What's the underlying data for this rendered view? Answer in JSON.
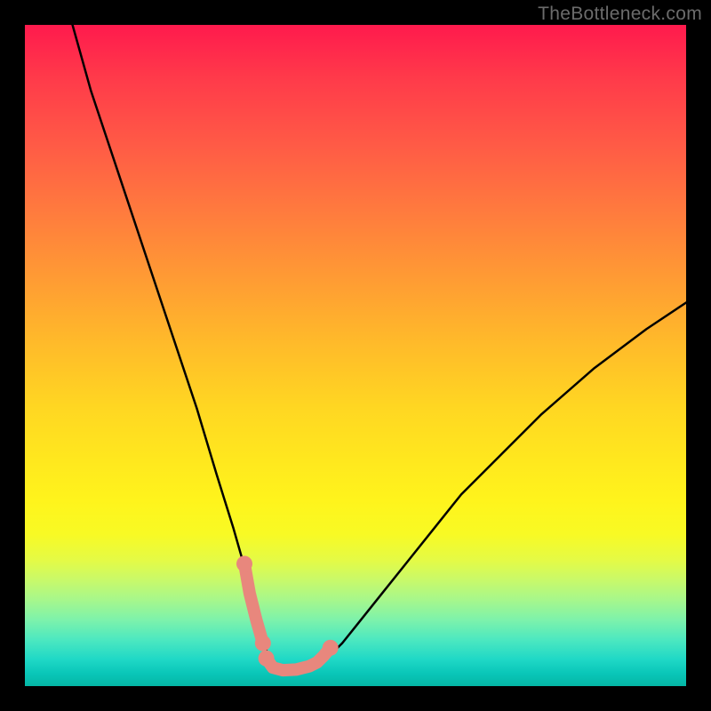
{
  "watermark": "TheBottleneck.com",
  "chart_data": {
    "type": "line",
    "title": "",
    "xlabel": "",
    "ylabel": "",
    "xlim": [
      0,
      100
    ],
    "ylim": [
      0,
      100
    ],
    "series": [
      {
        "name": "black-curve",
        "color": "#000000",
        "width": 2.5,
        "x": [
          7.2,
          10,
          14,
          18,
          22,
          26,
          29,
          31.5,
          33.5,
          35,
          36,
          37,
          38,
          40,
          42,
          44,
          46,
          48,
          50,
          54,
          58,
          62,
          66,
          72,
          78,
          86,
          94,
          100
        ],
        "y": [
          100,
          90,
          78,
          66,
          54,
          42,
          32,
          24,
          17,
          11,
          7,
          4,
          2.5,
          2.4,
          2.6,
          3.2,
          4.5,
          6.5,
          9,
          14,
          19,
          24,
          29,
          35,
          41,
          48,
          54,
          58
        ]
      },
      {
        "name": "salmon-overlay",
        "color": "#e8877d",
        "width": 14,
        "linecap": "round",
        "segments": [
          {
            "x": [
              33.2,
              34.0,
              35.0,
              36.0
            ],
            "y": [
              18.5,
              14,
              10,
              6.5
            ]
          },
          {
            "x": [
              36.5,
              37.5,
              39,
              41,
              43,
              44.2,
              45.2,
              46.2
            ],
            "y": [
              4.2,
              2.8,
              2.4,
              2.5,
              3.0,
              3.6,
              4.6,
              5.8
            ]
          }
        ],
        "end_dots": {
          "x": [
            33.2,
            36.0,
            36.5,
            46.2
          ],
          "y": [
            18.5,
            6.5,
            4.2,
            5.8
          ],
          "r": 9
        }
      }
    ]
  }
}
